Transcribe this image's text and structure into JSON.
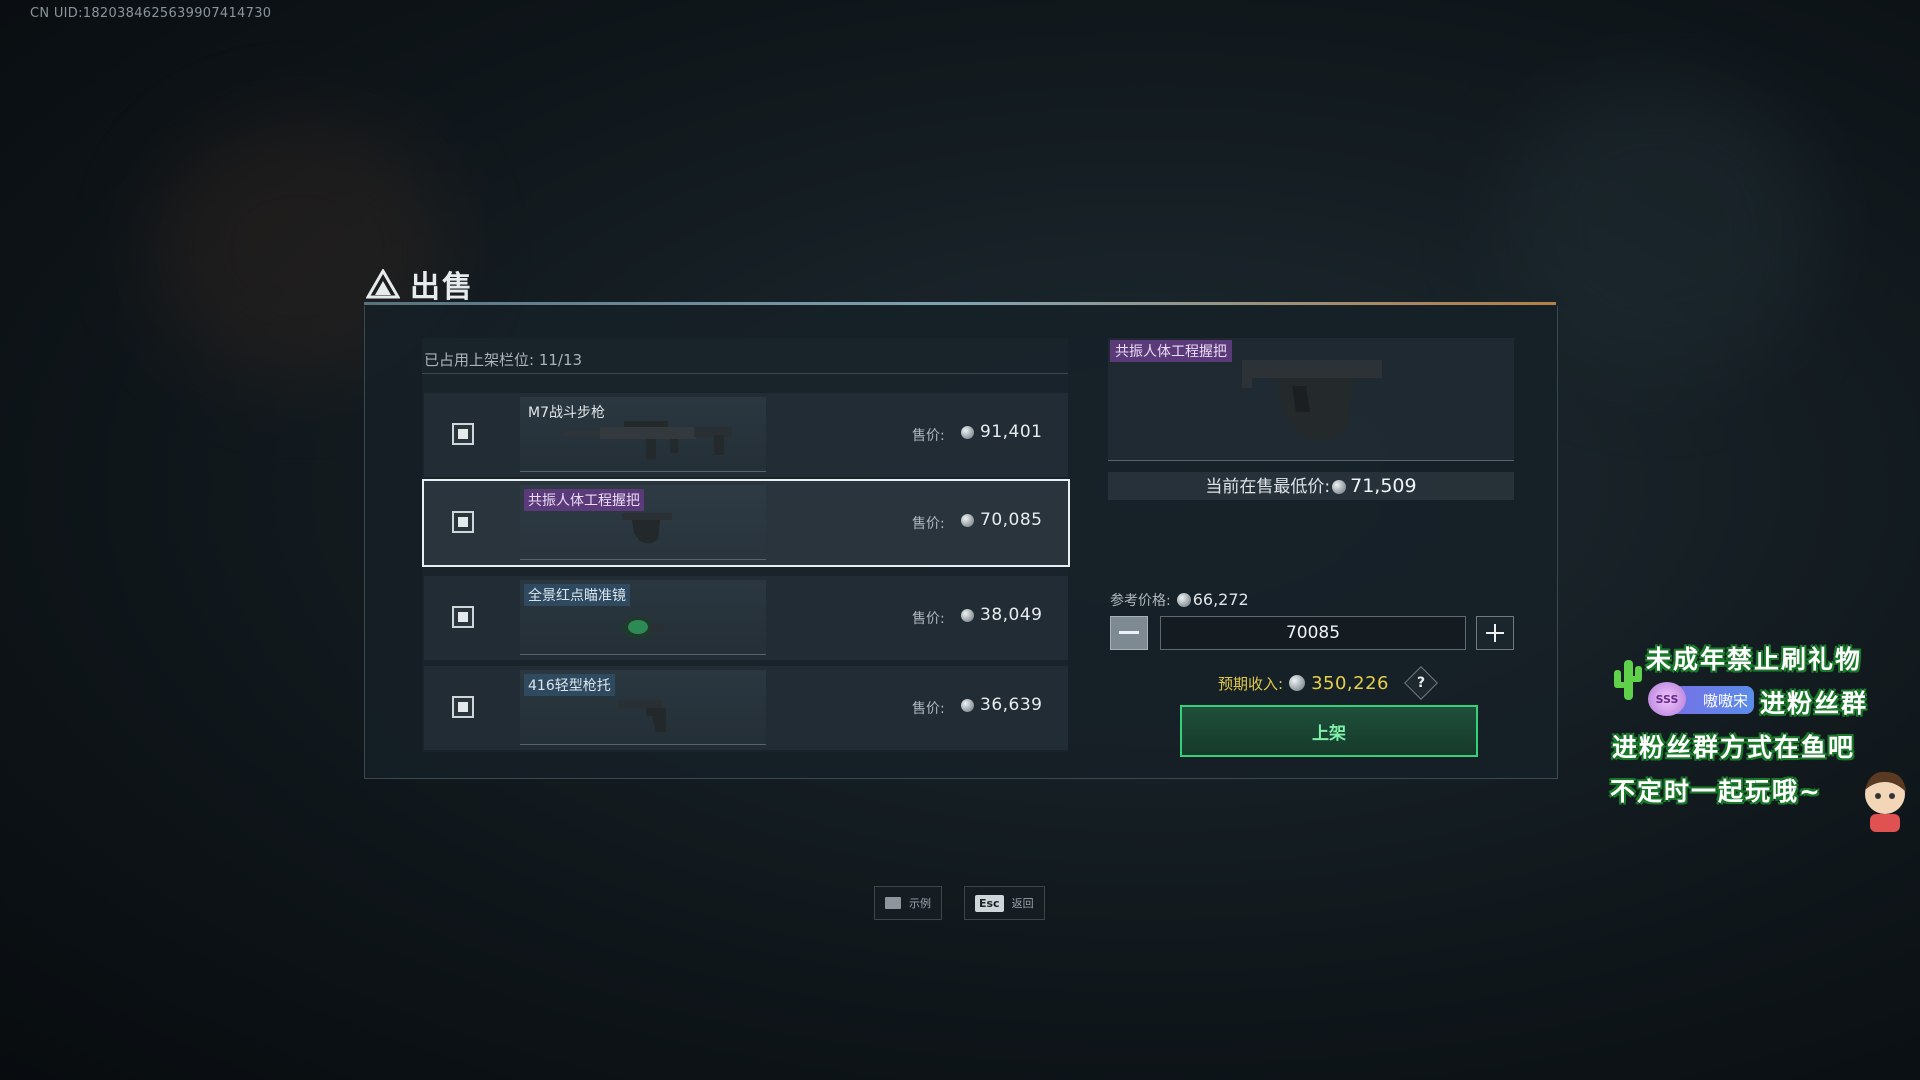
{
  "uid_text": "CN UID:1820384625639907414730",
  "header": {
    "title": "出售"
  },
  "list": {
    "slots_text": "已占用上架栏位: 11/13",
    "items": [
      {
        "name": "M7战斗步枪",
        "price_label": "售价:",
        "price": "91,401",
        "tag": "none"
      },
      {
        "name": "共振人体工程握把",
        "price_label": "售价:",
        "price": "70,085",
        "tag": "purple"
      },
      {
        "name": "全景红点瞄准镜",
        "price_label": "售价:",
        "price": "38,049",
        "tag": "blue"
      },
      {
        "name": "416轻型枪托",
        "price_label": "售价:",
        "price": "36,639",
        "tag": "blue"
      }
    ],
    "selected_index": 1
  },
  "detail": {
    "item_name": "共振人体工程握把",
    "lowest_label": "当前在售最低价:",
    "lowest_price": "71,509",
    "ref_label": "参考价格:",
    "ref_price": "66,272",
    "price_input": "70085",
    "income_label": "预期收入:",
    "income_value": "350,226",
    "help": "?",
    "list_button": "上架"
  },
  "hints": [
    {
      "key": "",
      "label": "示例",
      "icon": "book-icon"
    },
    {
      "key": "Esc",
      "label": "返回",
      "icon": ""
    }
  ],
  "overlay": {
    "line1": "未成年禁止刷礼物",
    "badge_text": "嗷嗷宋",
    "badge_level": "SSS",
    "line2": "进粉丝群",
    "line3": "进粉丝群方式在鱼吧",
    "line4": "不定时一起玩哦~"
  },
  "colors": {
    "accent_green": "#34d17a",
    "rarity_purple": "#5b3a79",
    "rarity_blue": "#2f4a5f",
    "income_gold": "#e8cf4a"
  }
}
